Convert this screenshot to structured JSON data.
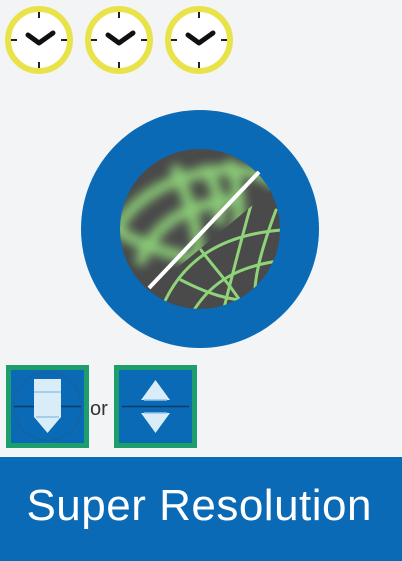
{
  "clocks": [
    {
      "icon": "clock-icon",
      "time": "2:20"
    },
    {
      "icon": "clock-icon",
      "time": "2:20"
    },
    {
      "icon": "clock-icon",
      "time": "2:20"
    }
  ],
  "microscope_view": {
    "icon": "blurred-vs-sharp-network-icon"
  },
  "modes": [
    {
      "icon": "downward-arrow-lens-icon"
    },
    {
      "icon": "double-arrow-lens-icon"
    }
  ],
  "separator_label": "or",
  "banner": {
    "title": "Super Resolution"
  },
  "colors": {
    "background": "#f3f4f6",
    "clock_ring": "#e8e34a",
    "ring_blue": "#0b6ab6",
    "frame_green": "#1f9e6d",
    "network_green": "#8fd37a",
    "banner_blue": "#0b6ab6"
  }
}
